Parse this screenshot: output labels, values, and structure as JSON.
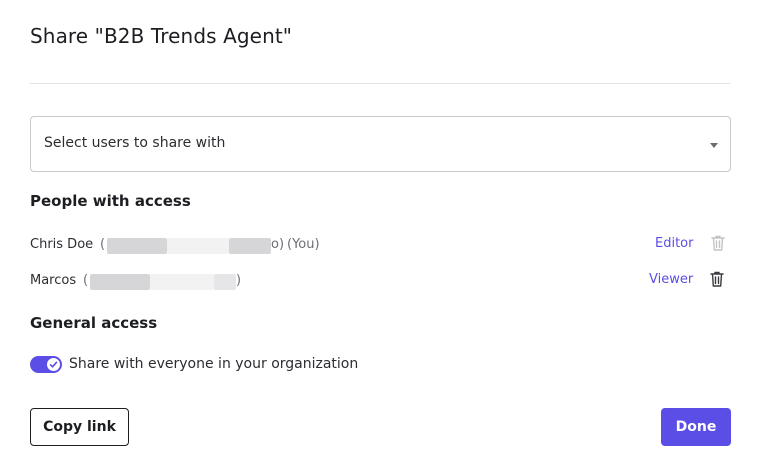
{
  "dialog": {
    "title": "Share \"B2B Trends Agent\"",
    "select": {
      "placeholder": "Select users to share with"
    },
    "people_section_title": "People with access",
    "people": [
      {
        "name": "Chris Doe",
        "email_open": "(",
        "email_tail": "o)",
        "you_label": "(You)",
        "role": "Editor",
        "delete_enabled": false
      },
      {
        "name": "Marcos",
        "email_open": "(",
        "email_tail": ")",
        "role": "Viewer",
        "delete_enabled": true
      }
    ],
    "general_section_title": "General access",
    "share_toggle": {
      "label": "Share with everyone in your organization",
      "on": true
    },
    "copy_link_label": "Copy link",
    "done_label": "Done"
  },
  "colors": {
    "accent": "#5b4ee6",
    "text": "#1c1e21",
    "muted": "#6e6e76",
    "border": "#c9c9cf",
    "trash_disabled": "#c4c4c8",
    "trash_enabled": "#3a3a40"
  }
}
